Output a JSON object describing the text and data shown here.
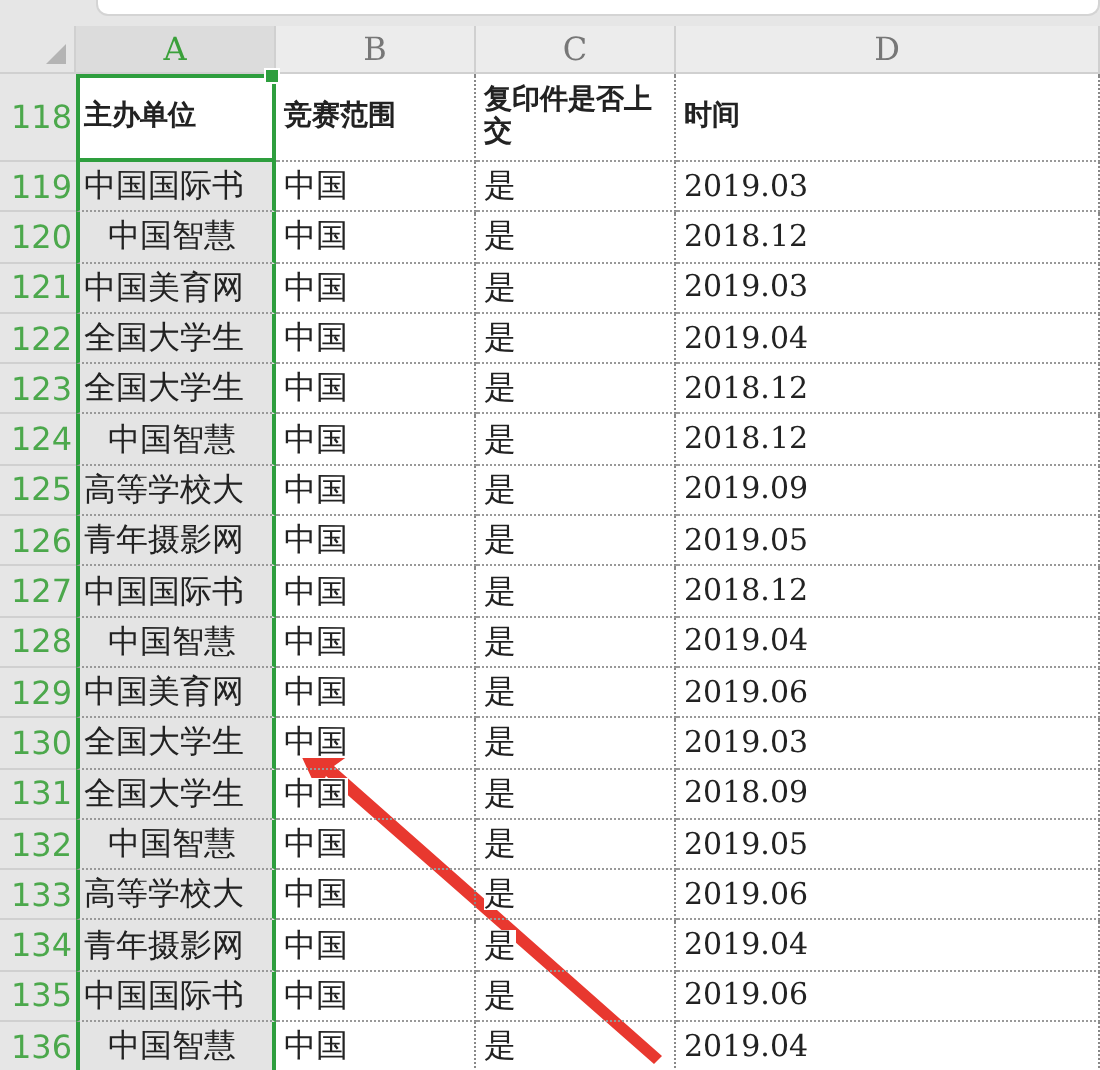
{
  "columns": [
    {
      "label": "A",
      "selected": true
    },
    {
      "label": "B",
      "selected": false
    },
    {
      "label": "C",
      "selected": false
    },
    {
      "label": "D",
      "selected": false
    }
  ],
  "header_row": {
    "number": "118",
    "cells": [
      {
        "text": "主办单位",
        "active": true
      },
      {
        "text": "竞赛范围",
        "active": false
      },
      {
        "text": "复印件是否上交",
        "active": false
      },
      {
        "text": "时间",
        "active": false
      }
    ]
  },
  "rows": [
    {
      "number": "119",
      "unit": "中国国际书",
      "unit_indented": false,
      "scope": "中国",
      "copy_submitted": "是",
      "time": "2019.03"
    },
    {
      "number": "120",
      "unit": "中国智慧",
      "unit_indented": true,
      "scope": "中国",
      "copy_submitted": "是",
      "time": "2018.12"
    },
    {
      "number": "121",
      "unit": "中国美育网",
      "unit_indented": false,
      "scope": "中国",
      "copy_submitted": "是",
      "time": "2019.03"
    },
    {
      "number": "122",
      "unit": "全国大学生",
      "unit_indented": false,
      "scope": "中国",
      "copy_submitted": "是",
      "time": "2019.04"
    },
    {
      "number": "123",
      "unit": "全国大学生",
      "unit_indented": false,
      "scope": "中国",
      "copy_submitted": "是",
      "time": "2018.12"
    },
    {
      "number": "124",
      "unit": "中国智慧",
      "unit_indented": true,
      "scope": "中国",
      "copy_submitted": "是",
      "time": "2018.12"
    },
    {
      "number": "125",
      "unit": "高等学校大",
      "unit_indented": false,
      "scope": "中国",
      "copy_submitted": "是",
      "time": "2019.09"
    },
    {
      "number": "126",
      "unit": "青年摄影网",
      "unit_indented": false,
      "scope": "中国",
      "copy_submitted": "是",
      "time": "2019.05"
    },
    {
      "number": "127",
      "unit": "中国国际书",
      "unit_indented": false,
      "scope": "中国",
      "copy_submitted": "是",
      "time": "2018.12"
    },
    {
      "number": "128",
      "unit": "中国智慧",
      "unit_indented": true,
      "scope": "中国",
      "copy_submitted": "是",
      "time": "2019.04"
    },
    {
      "number": "129",
      "unit": "中国美育网",
      "unit_indented": false,
      "scope": "中国",
      "copy_submitted": "是",
      "time": "2019.06"
    },
    {
      "number": "130",
      "unit": "全国大学生",
      "unit_indented": false,
      "scope": "中国",
      "copy_submitted": "是",
      "time": "2019.03"
    },
    {
      "number": "131",
      "unit": "全国大学生",
      "unit_indented": false,
      "scope": "中国",
      "copy_submitted": "是",
      "time": "2018.09"
    },
    {
      "number": "132",
      "unit": "中国智慧",
      "unit_indented": true,
      "scope": "中国",
      "copy_submitted": "是",
      "time": "2019.05"
    },
    {
      "number": "133",
      "unit": "高等学校大",
      "unit_indented": false,
      "scope": "中国",
      "copy_submitted": "是",
      "time": "2019.06"
    },
    {
      "number": "134",
      "unit": "青年摄影网",
      "unit_indented": false,
      "scope": "中国",
      "copy_submitted": "是",
      "time": "2019.04"
    },
    {
      "number": "135",
      "unit": "中国国际书",
      "unit_indented": false,
      "scope": "中国",
      "copy_submitted": "是",
      "time": "2019.06"
    },
    {
      "number": "136",
      "unit": "中国智慧",
      "unit_indented": true,
      "scope": "中国",
      "copy_submitted": "是",
      "time": "2019.04"
    }
  ]
}
